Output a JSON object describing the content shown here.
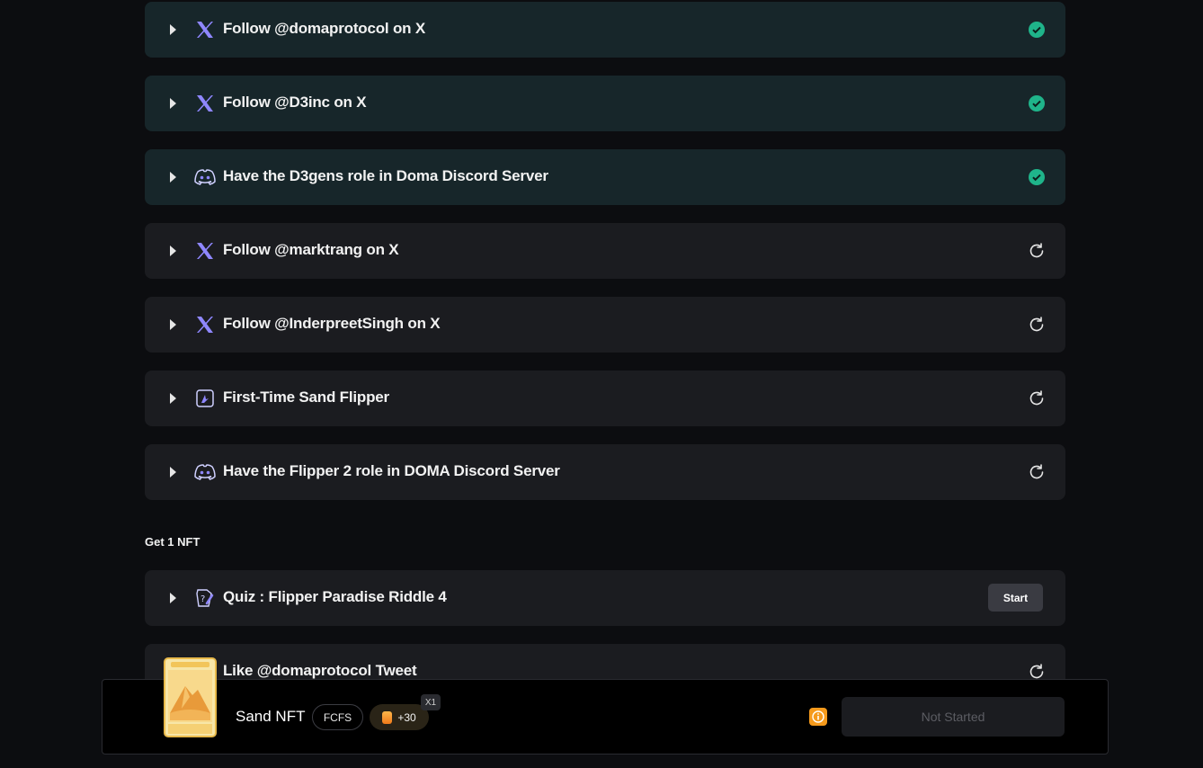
{
  "tasks": [
    {
      "label": "Follow @domaprotocol on X",
      "icon": "x-logo-icon",
      "status": "completed"
    },
    {
      "label": "Follow @D3inc on X",
      "icon": "x-logo-icon",
      "status": "completed"
    },
    {
      "label": "Have the D3gens role in Doma Discord Server",
      "icon": "discord-icon",
      "status": "completed"
    },
    {
      "label": "Follow @marktrang on X",
      "icon": "x-logo-icon",
      "status": "pending"
    },
    {
      "label": "Follow @InderpreetSingh on X",
      "icon": "x-logo-icon",
      "status": "pending"
    },
    {
      "label": "First-Time Sand Flipper",
      "icon": "flipper-app-icon",
      "status": "pending"
    },
    {
      "label": "Have the Flipper 2 role in DOMA Discord Server",
      "icon": "discord-icon",
      "status": "pending"
    }
  ],
  "section": {
    "title": "Get 1 NFT"
  },
  "quiz": {
    "label": "Quiz : Flipper Paradise Riddle 4",
    "icon": "quiz-icon",
    "start_label": "Start"
  },
  "like_task": {
    "label": "Like @domaprotocol Tweet",
    "icon": "x-logo-icon",
    "status": "pending"
  },
  "reward": {
    "name": "Sand NFT",
    "tag": "FCFS",
    "points": "+30",
    "multiplier": "X1",
    "action_label": "Not Started"
  },
  "colors": {
    "accent": "#7a5cff",
    "check": "#1fb48a",
    "info": "#f59a1c"
  }
}
